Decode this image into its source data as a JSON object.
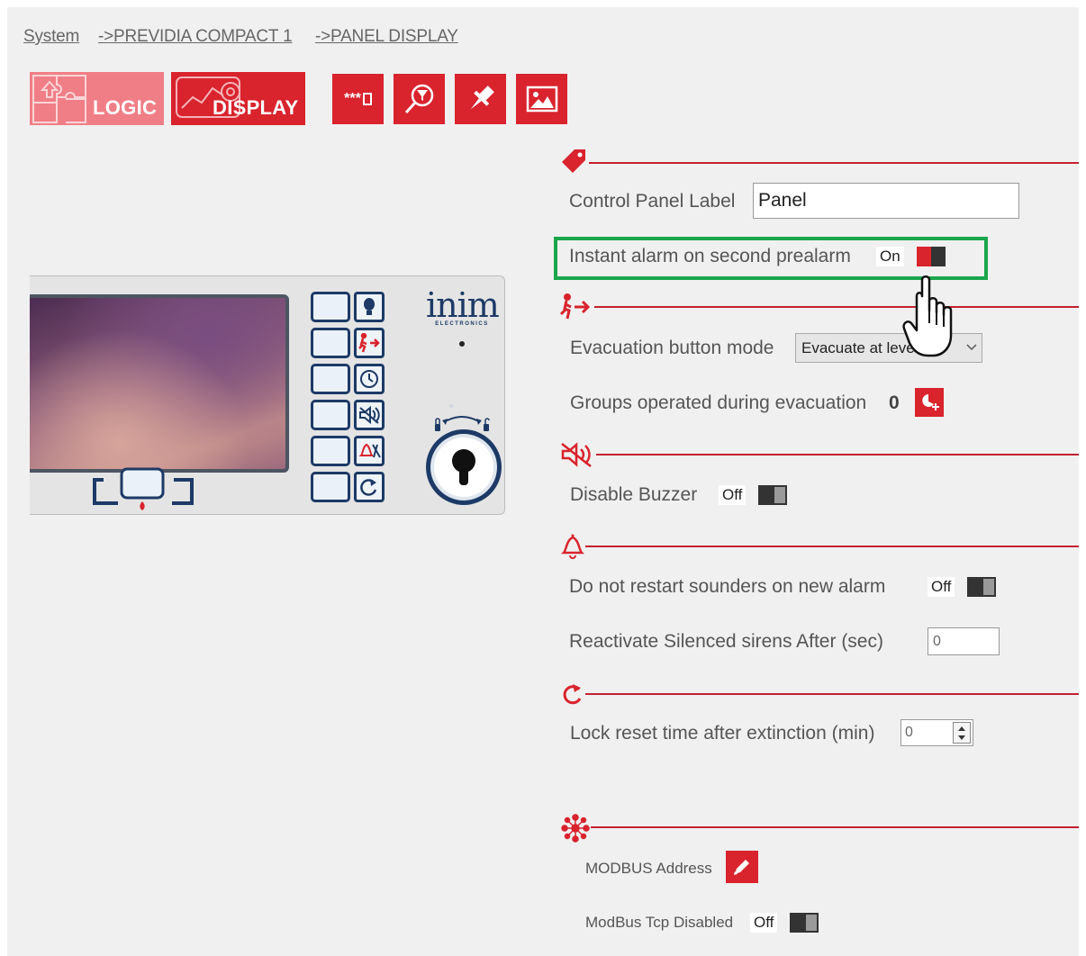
{
  "breadcrumb": [
    {
      "label": "System"
    },
    {
      "label": "->PREVIDIA COMPACT 1"
    },
    {
      "label": "->PANEL DISPLAY"
    }
  ],
  "toolbar": {
    "logic_label": "LOGIC",
    "display_label": "DISPLAY",
    "password_label": "***"
  },
  "device": {
    "brand": "inim",
    "brand_sub": "ELECTRONICS"
  },
  "settings": {
    "control_panel_label": {
      "label": "Control Panel Label",
      "value": "Panel"
    },
    "instant_alarm": {
      "label": "Instant alarm on second prealarm",
      "state": "On"
    },
    "evacuation_mode": {
      "label": "Evacuation button mode",
      "value": "Evacuate at level"
    },
    "groups_evacuation": {
      "label": "Groups operated during evacuation",
      "count": "0"
    },
    "disable_buzzer": {
      "label": "Disable Buzzer",
      "state": "Off"
    },
    "restart_sounders": {
      "label": "Do not restart sounders on new alarm",
      "state": "Off"
    },
    "reactivate_sirens": {
      "label": "Reactivate Silenced sirens After (sec)",
      "value": "0"
    },
    "lock_reset": {
      "label": "Lock reset time after extinction (min)",
      "value": "0"
    },
    "modbus_address": {
      "label": "MODBUS Address"
    },
    "modbus_tcp": {
      "label": "ModBus Tcp Disabled",
      "state": "Off"
    }
  },
  "colors": {
    "accent": "#d9232d",
    "section_line": "#c42030",
    "highlight": "#1aa64b",
    "device_blue": "#1d3a66"
  }
}
